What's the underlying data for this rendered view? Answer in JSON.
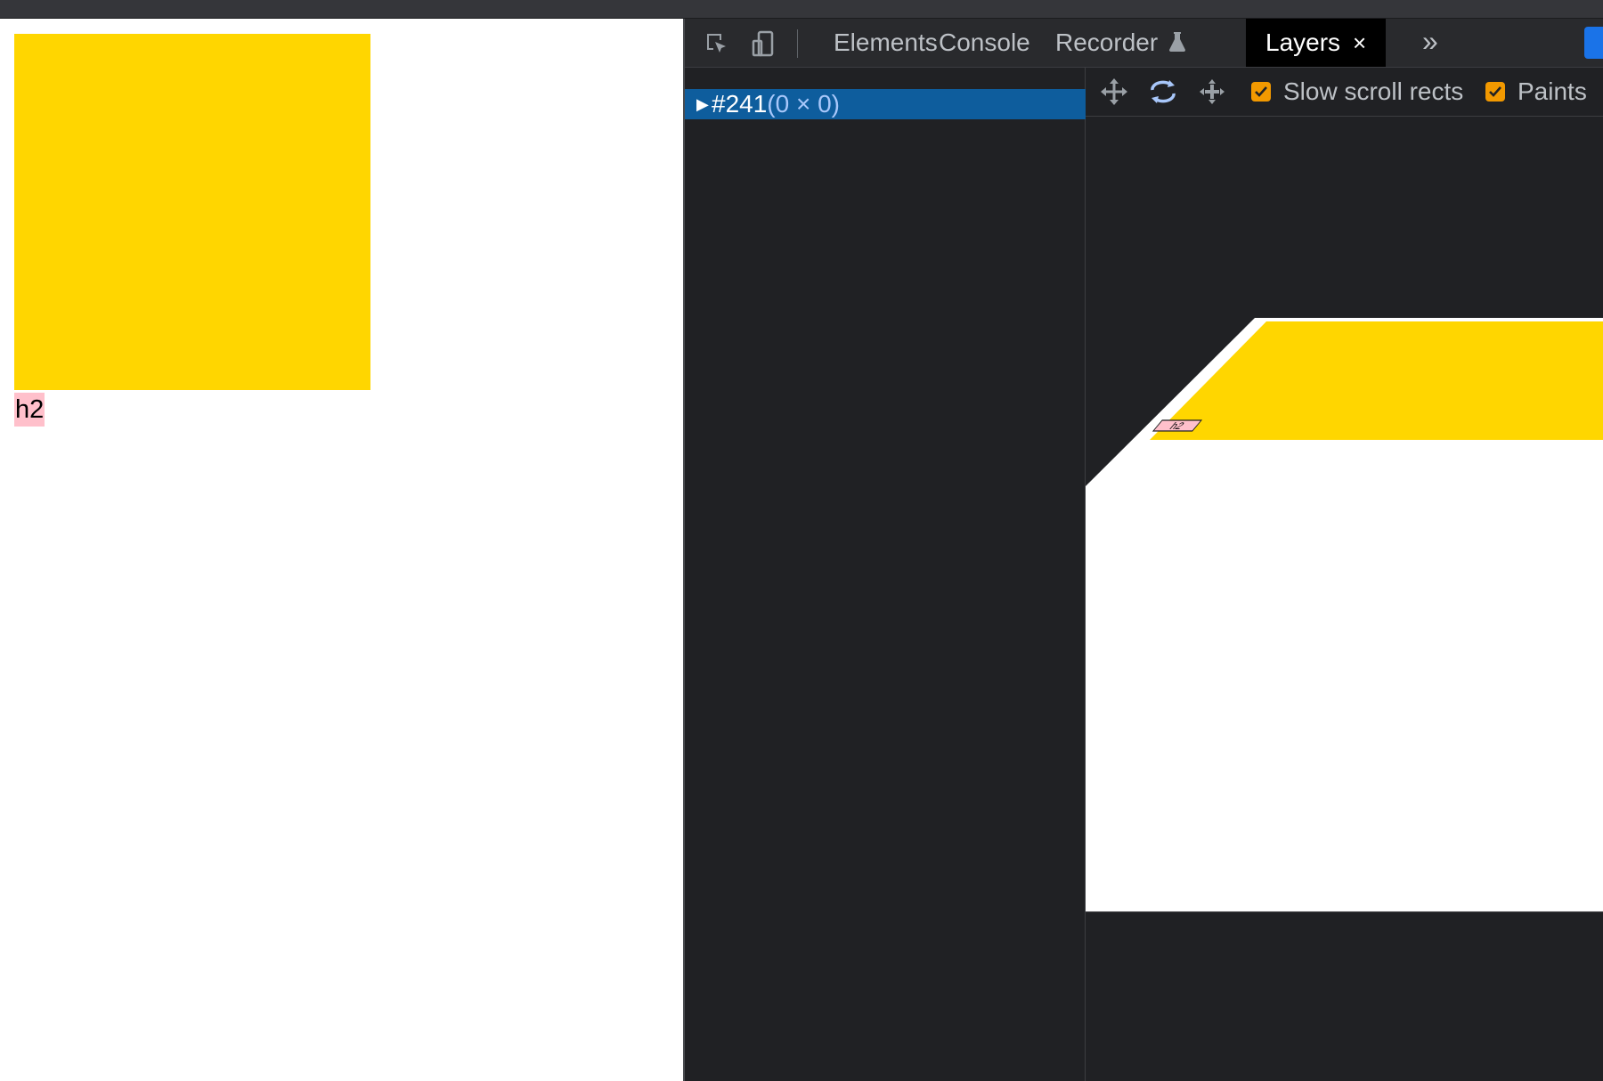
{
  "page": {
    "heading": "h2",
    "box_color": "#ffd600",
    "heading_highlight": "#ffc0cb"
  },
  "devtools": {
    "toolbar_icons": [
      "inspect-element-icon",
      "device-toolbar-icon"
    ],
    "tabs": [
      {
        "label": "Elements",
        "active": false
      },
      {
        "label": "Console",
        "active": false
      },
      {
        "label": "Recorder",
        "active": false,
        "icon": "flask-icon"
      },
      {
        "label": "Layers",
        "active": true,
        "closable": true
      }
    ],
    "close_glyph": "×",
    "more_tabs_glyph": "»",
    "layer_tree": {
      "selected_id": "#241",
      "selected_size": "(0 × 0)"
    },
    "viewer_toolbar": {
      "tools": [
        "pan-mode-icon",
        "rotate-mode-icon",
        "reset-transform-icon"
      ],
      "slow_scroll_rects": {
        "label": "Slow scroll rects",
        "checked": true
      },
      "paints": {
        "label": "Paints",
        "checked": true
      }
    },
    "layer_3d": {
      "label": "h2"
    },
    "colors": {
      "accent_checkbox": "#f29900",
      "selected_row": "#0e5d9d",
      "panel_bg": "#202124"
    }
  }
}
